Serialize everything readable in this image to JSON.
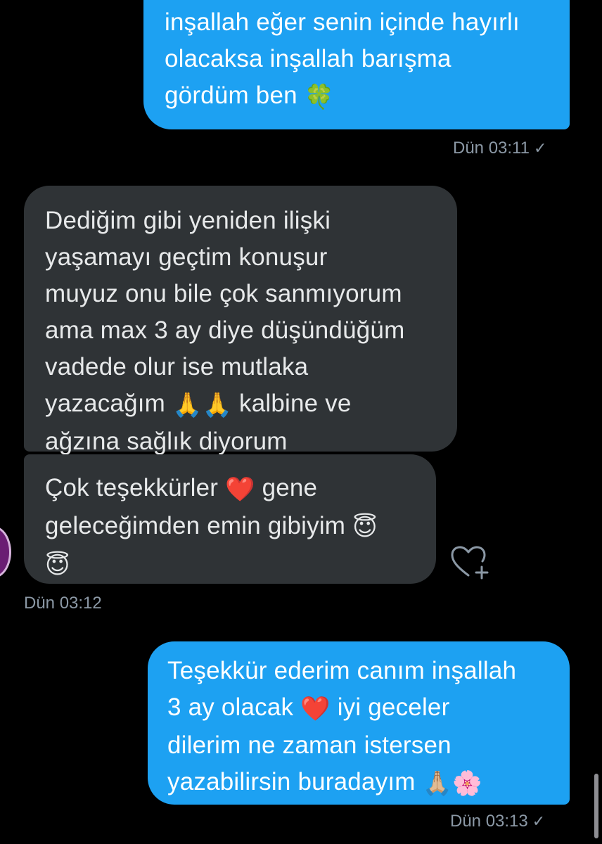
{
  "messages": [
    {
      "direction": "outgoing",
      "lines": [
        "inşallah eğer senin içinde hayırlı",
        "olacaksa inşallah barışma",
        "gördüm ben"
      ],
      "emoji_end": "🍀",
      "emoji_name": "four-leaf-clover"
    },
    {
      "direction": "incoming",
      "lines": [
        "Dediğim gibi yeniden ilişki",
        "yaşamayı geçtim konuşur",
        "muyuz onu bile çok sanmıyorum",
        "ama max 3 ay diye düşündüğüm",
        "vadede olur ise mutlaka",
        "yazacağım",
        "ağzına sağlık diyorum"
      ],
      "line6_emoji": "🙏🙏",
      "line6_tail": "kalbine ve"
    },
    {
      "direction": "incoming",
      "line1_a": "Çok teşekkürler",
      "line1_emoji": "❤️",
      "line1_b": "gene",
      "line2": "geleceğimden emin gibiyim",
      "line2_emoji": "😇",
      "line3_emoji": "😇"
    },
    {
      "direction": "outgoing",
      "lines": [
        "Teşekkür ederim canım inşallah",
        "3 ay olacak",
        "dilerim ne zaman istersen",
        "yazabilirsin buradayım"
      ],
      "line2_emoji": "❤️",
      "line2_tail": "iyi geceler",
      "line4_emoji": "🙏🏼🌸"
    }
  ],
  "timestamps": {
    "first": "Dün 03:11",
    "second": "Dün 03:12",
    "third": "Dün 03:13"
  },
  "status_icon": "✓",
  "icons": {
    "like": "heart-plus-icon",
    "avatar": "avatar"
  },
  "colors": {
    "background": "#000000",
    "outgoing_bubble": "#1da1f2",
    "incoming_bubble": "#2f3336",
    "timestamp": "#8b98a5"
  }
}
